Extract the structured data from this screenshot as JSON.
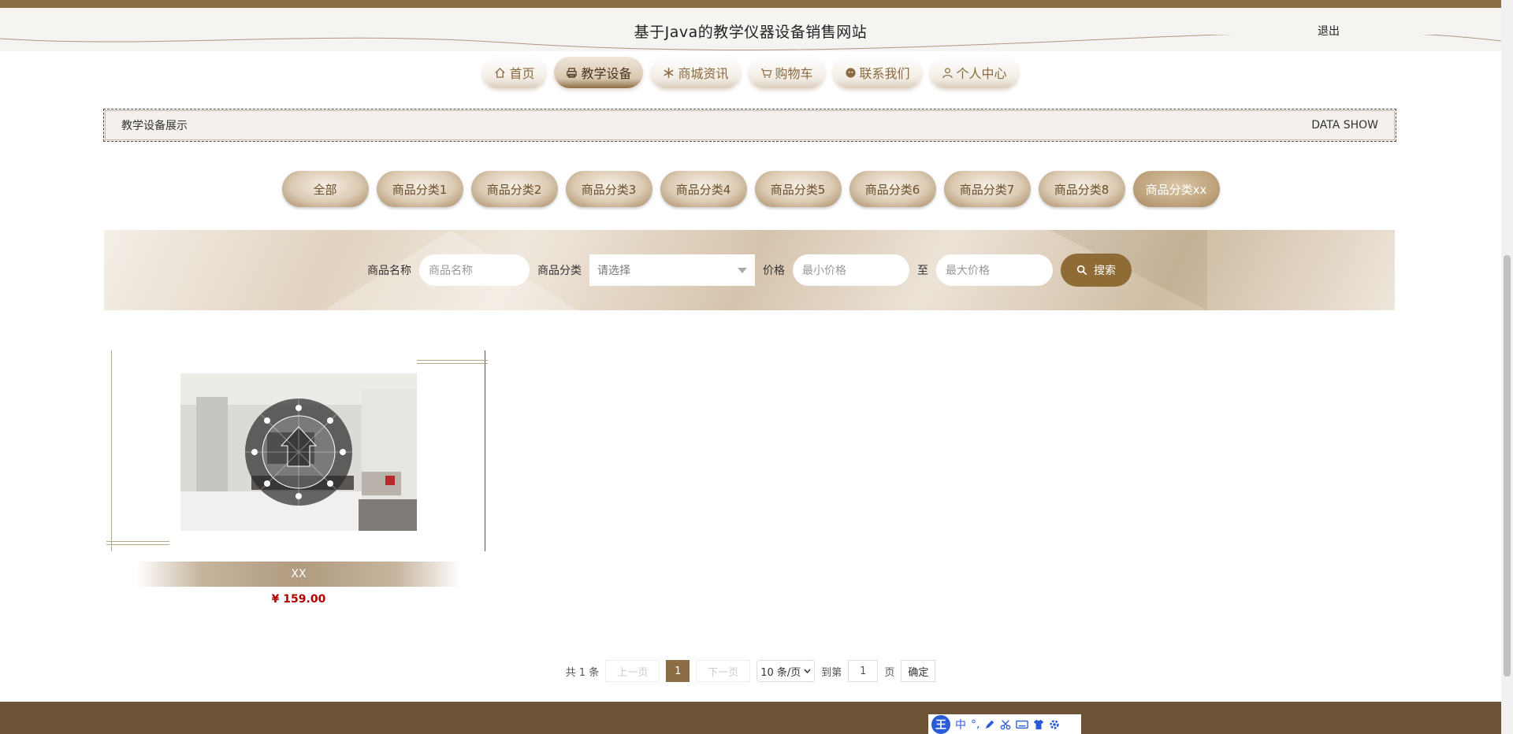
{
  "header": {
    "title": "基于Java的教学仪器设备销售网站",
    "logout_label": "退出"
  },
  "nav": {
    "items": [
      {
        "label": "首页",
        "icon": "home-icon",
        "active": false
      },
      {
        "label": "教学设备",
        "icon": "printer-icon",
        "active": true
      },
      {
        "label": "商城资讯",
        "icon": "snowflake-icon",
        "active": false
      },
      {
        "label": "购物车",
        "icon": "cart-icon",
        "active": false
      },
      {
        "label": "联系我们",
        "icon": "chat-icon",
        "active": false
      },
      {
        "label": "个人中心",
        "icon": "user-icon",
        "active": false
      }
    ]
  },
  "section": {
    "title": "教学设备展示",
    "subtitle": "DATA SHOW"
  },
  "categories": [
    "全部",
    "商品分类1",
    "商品分类2",
    "商品分类3",
    "商品分类4",
    "商品分类5",
    "商品分类6",
    "商品分类7",
    "商品分类8",
    "商品分类xx"
  ],
  "search": {
    "name_label": "商品名称",
    "name_placeholder": "商品名称",
    "category_label": "商品分类",
    "category_placeholder": "请选择",
    "price_label": "价格",
    "min_placeholder": "最小价格",
    "to_label": "至",
    "max_placeholder": "最大价格",
    "button_label": "搜索"
  },
  "products": [
    {
      "name": "XX",
      "price": "¥ 159.00"
    }
  ],
  "pagination": {
    "total_text": "共 1 条",
    "prev_label": "上一页",
    "current_page": "1",
    "next_label": "下一页",
    "page_size": "10 条/页",
    "goto_label": "到第",
    "goto_value": "1",
    "page_unit": "页",
    "confirm_label": "确定"
  },
  "ime_toolbar": {
    "logo": "王",
    "mode": "中",
    "punct": "°,"
  },
  "colors": {
    "brand": "#8c6c44",
    "footer": "#6d5336",
    "price": "#b20000",
    "search_button": "#8f6c35"
  }
}
